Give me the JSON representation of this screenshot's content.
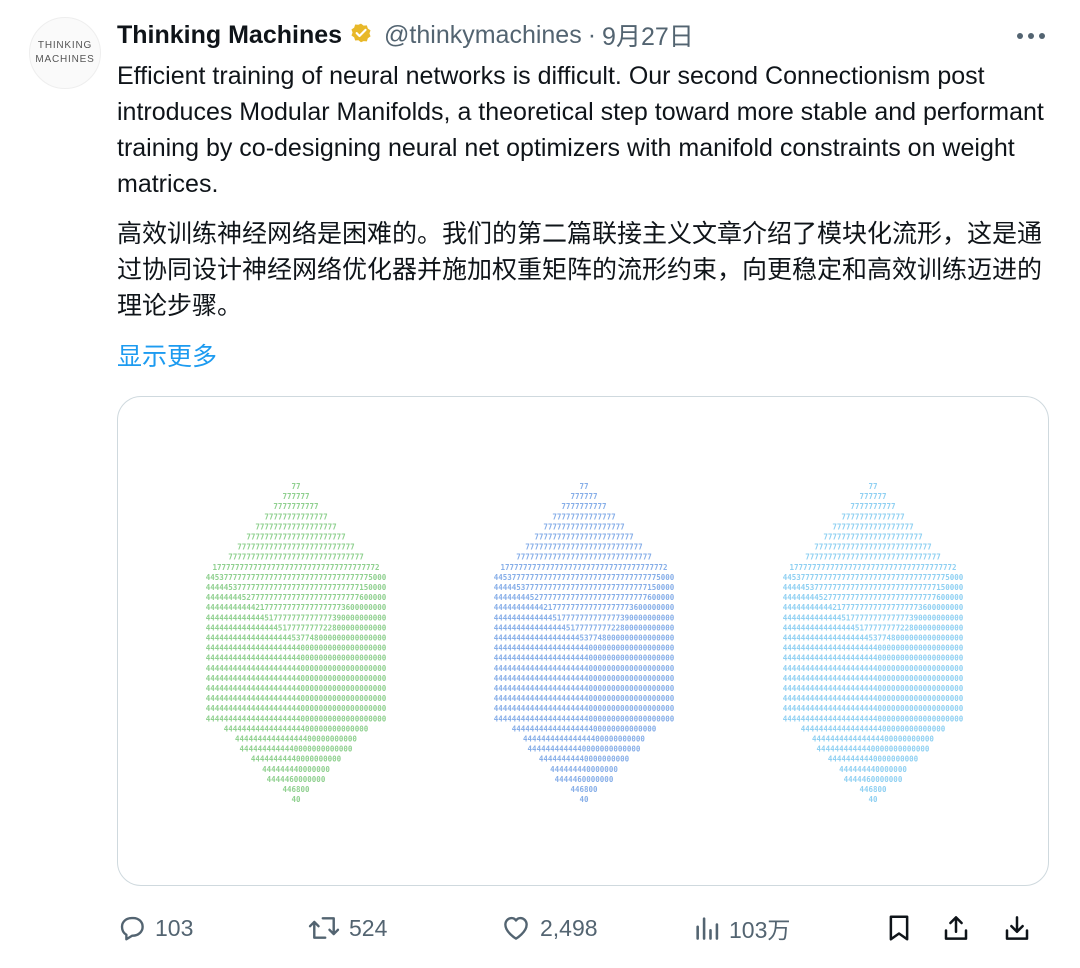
{
  "author": {
    "avatar_text": [
      "THINKING",
      "MACHINES"
    ],
    "display_name": "Thinking Machines",
    "verified_badge": "gold-verified-icon",
    "handle": "@thinkymachines",
    "separator": "·",
    "date": "9月27日"
  },
  "tweet": {
    "text_en": "Efficient training of neural networks is difficult. Our second Connectionism post introduces Modular Manifolds, a theoretical step toward more stable and performant training by co-designing neural net optimizers with manifold constraints on weight matrices.",
    "text_zh": "高效训练神经网络是困难的。我们的第二篇联接主义文章介绍了模块化流形，这是通过协同设计神经网络优化器并施加权重矩阵的流形约束，向更稳定和高效训练迈进的理论步骤。",
    "show_more": "显示更多"
  },
  "media": {
    "description_icons": [
      "hexagon-glyph-art"
    ],
    "hexagon_colors": [
      "#8fd08f",
      "#86aee8",
      "#8fd0f2"
    ],
    "glyph_rows": [
      "77",
      "777777",
      "7777777777",
      "77777777777777",
      "777777777777777777",
      "7777777777777777777777",
      "77777777777777777777777777",
      "777777777777777777777777777777",
      "1777777777777777777777777777777777772",
      "4453777777777777777777777777777777775000",
      "4444453777777777777777777777777777150000",
      "4444444452777777777777777777777777600000",
      "4444444444421777777777777777773600000000",
      "4444444444444517777777777777390000000000",
      "4444444444444444517777777722800000000000",
      "4444444444444444444537748000000000000000",
      "4444444444444444444440000000000000000000",
      "4444444444444444444440000000000000000000",
      "4444444444444444444440000000000000000000",
      "4444444444444444444440000000000000000000",
      "4444444444444444444440000000000000000000",
      "4444444444444444444440000000000000000000",
      "4444444444444444444440000000000000000000",
      "4444444444444444444440000000000000000000",
      "44444444444444444400000000000000",
      "444444444444444400000000000",
      "4444444444440000000000000",
      "44444444440000000000",
      "444444440000000",
      "4444460000000",
      "446800",
      "40"
    ]
  },
  "actions": {
    "reply": {
      "icon": "reply-icon",
      "count": "103"
    },
    "retweet": {
      "icon": "retweet-icon",
      "count": "524"
    },
    "like": {
      "icon": "heart-icon",
      "count": "2,498"
    },
    "views": {
      "icon": "views-icon",
      "count": "103万"
    },
    "bookmark": {
      "icon": "bookmark-icon"
    },
    "share": {
      "icon": "share-icon"
    },
    "download": {
      "icon": "download-icon"
    }
  },
  "colors": {
    "text": "#0f1419",
    "secondary": "#536471",
    "link": "#1d9bf0",
    "border": "#cfd9de",
    "verified": "#e8b829"
  }
}
